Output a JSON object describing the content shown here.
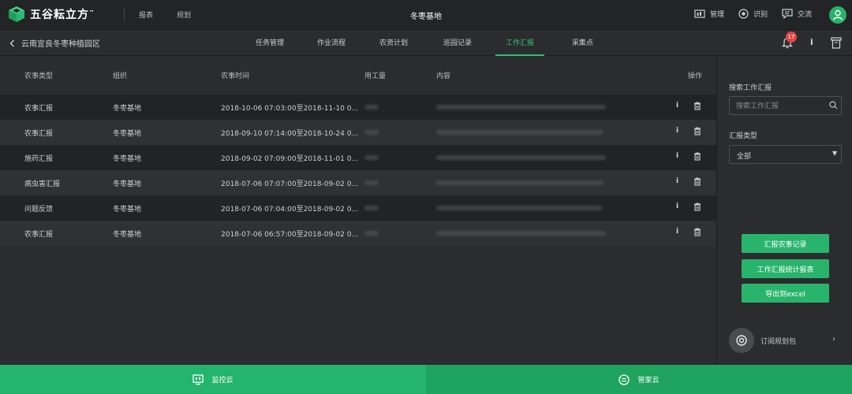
{
  "header": {
    "logo_text": "五谷耘立方",
    "logo_tm": "™",
    "links": [
      "报表",
      "规划"
    ],
    "title": "冬枣基地",
    "tools": [
      {
        "label": "管理",
        "icon": "dashboard-icon"
      },
      {
        "label": "识别",
        "icon": "scan-icon"
      },
      {
        "label": "交流",
        "icon": "chat-icon"
      }
    ],
    "avatar_icon": "user-avatar-icon"
  },
  "subnav": {
    "back_label": "云南宜良冬枣种植园区",
    "tabs": [
      "任务管理",
      "作业流程",
      "农资计划",
      "巡园记录",
      "工作汇报",
      "采集点"
    ],
    "active_tab": "工作汇报",
    "notification_count": "17",
    "info_label": "i"
  },
  "table": {
    "columns": [
      "农事类型",
      "组织",
      "农事时间",
      "用工量",
      "内容",
      "操作"
    ],
    "rows": [
      {
        "type": "农事汇报",
        "org": "冬枣基地",
        "time": "2018-10-06 07:03:00至2018-11-10 0..."
      },
      {
        "type": "农事汇报",
        "org": "冬枣基地",
        "time": "2018-09-10 07:14:00至2018-10-24 0..."
      },
      {
        "type": "施药汇报",
        "org": "冬枣基地",
        "time": "2018-09-02 07:09:00至2018-11-01 0..."
      },
      {
        "type": "病虫害汇报",
        "org": "冬枣基地",
        "time": "2018-07-06 07:07:00至2018-09-02 0..."
      },
      {
        "type": "问题反馈",
        "org": "冬枣基地",
        "time": "2018-07-06 07:04:00至2018-09-02 0..."
      },
      {
        "type": "农事汇报",
        "org": "冬枣基地",
        "time": "2018-07-06 06:57:00至2018-09-02 0..."
      }
    ],
    "action_info": "i"
  },
  "sidebar": {
    "search_label": "搜索工作汇报",
    "search_placeholder": "搜索工作汇报",
    "type_label": "汇报类型",
    "type_value": "全部",
    "buttons": [
      "汇报农事记录",
      "工作汇报统计报表",
      "导出到excel"
    ],
    "subscribe_label": "订阅规划包",
    "subscribe_arrow": "›"
  },
  "footer": {
    "left_label": "监控云",
    "right_label": "管家云"
  },
  "colors": {
    "accent": "#2ebd75",
    "footer_left": "#25b46c",
    "footer_right": "#1fa45f",
    "badge": "#e04545"
  }
}
